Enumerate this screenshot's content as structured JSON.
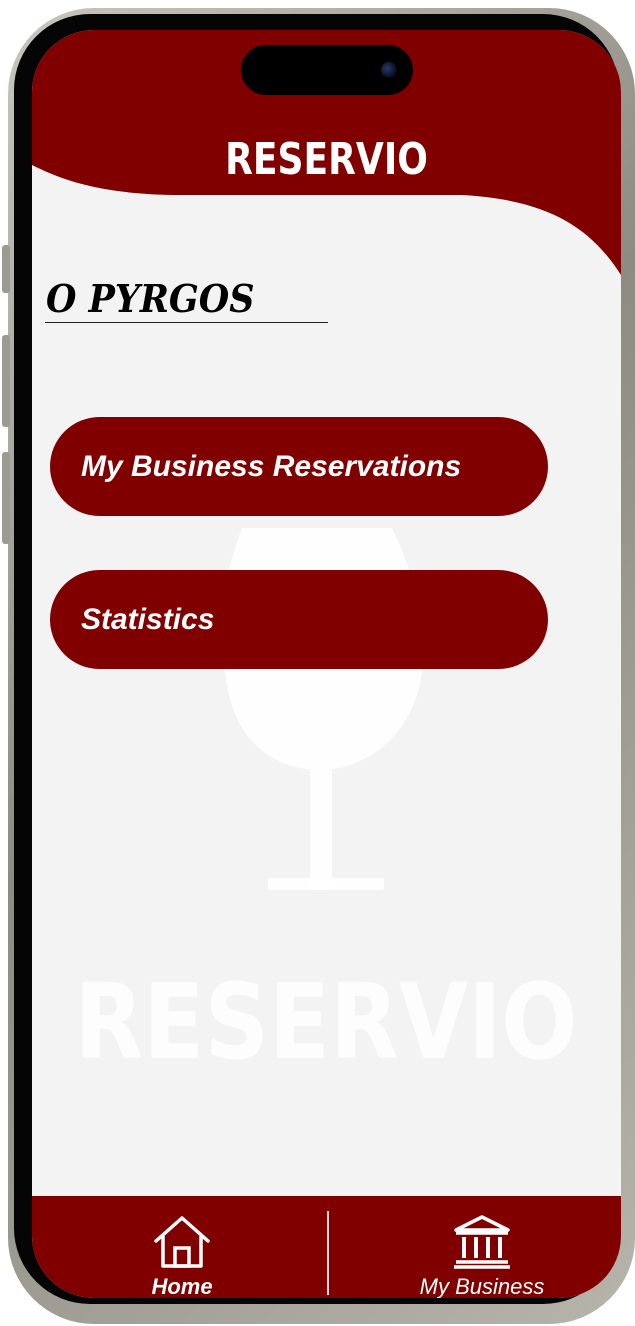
{
  "app": {
    "title": "RESERVIO"
  },
  "business": {
    "name": "O PYRGOS"
  },
  "menu": {
    "reservations_label": "My Business Reservations",
    "statistics_label": "Statistics"
  },
  "watermark": {
    "text": "RESERVIO",
    "icon": "wine-glass-icon"
  },
  "bottom_nav": {
    "items": [
      {
        "label": "Home",
        "icon": "home-icon",
        "active": true
      },
      {
        "label": "My Business",
        "icon": "bank-building-icon",
        "active": false
      }
    ]
  },
  "colors": {
    "primary": "#800000",
    "background": "#f3f3f4",
    "text_on_primary": "#ffffff"
  }
}
